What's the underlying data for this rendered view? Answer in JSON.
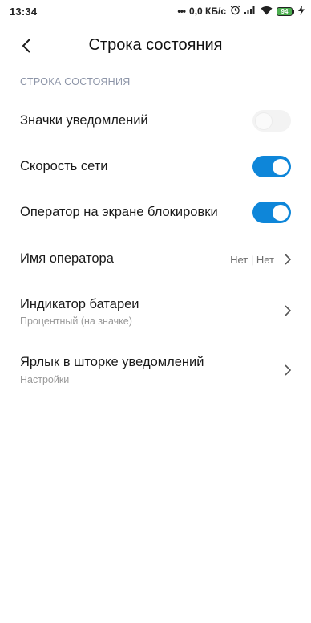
{
  "status_bar": {
    "time": "13:34",
    "dots": "•••",
    "speed": "0,0 КБ/с",
    "battery": "94"
  },
  "header": {
    "title": "Строка состояния"
  },
  "section": {
    "title": "СТРОКА СОСТОЯНИЯ"
  },
  "settings": [
    {
      "label": "Значки уведомлений",
      "toggle": "off"
    },
    {
      "label": "Скорость сети",
      "toggle": "on"
    },
    {
      "label": "Оператор на экране блокировки",
      "toggle": "on"
    },
    {
      "label": "Имя оператора",
      "value": "Нет | Нет"
    },
    {
      "label": "Индикатор батареи",
      "subtitle": "Процентный (на значке)"
    },
    {
      "label": "Ярлык в шторке уведомлений",
      "subtitle": "Настройки"
    }
  ],
  "colors": {
    "accent": "#0e86d9",
    "section_header": "#8d95a8",
    "battery": "#4caf50"
  }
}
